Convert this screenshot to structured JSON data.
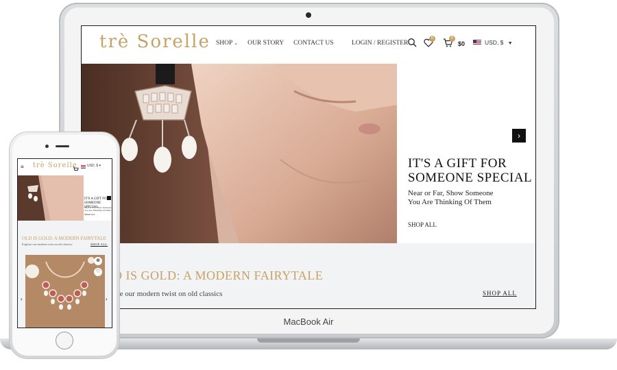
{
  "site": {
    "logo_text": "trè Sorelle",
    "nav": [
      "SHOP",
      "OUR STORY",
      "CONTACT US"
    ],
    "login_label": "LOGIN / REGISTER",
    "wishlist_count": "0",
    "cart_count": "0",
    "cart_total": "$0",
    "currency": "USD, $"
  },
  "hero": {
    "title_line1": "IT'S A GIFT FOR",
    "title_line2": "SOMEONE SPECIAL",
    "subtitle_line1": "Near or Far, Show Someone",
    "subtitle_line2": "You Are Thinking Of Them",
    "link_label": "SHOP ALL",
    "next_icon": "›"
  },
  "collection": {
    "title_visible": "D IS GOLD: A MODERN FAIRYTALE",
    "subtitle_visible": "re our modern twist on old classics",
    "link_label": "SHOP ALL"
  },
  "device": {
    "brand_label": "MacBook Air"
  },
  "phone": {
    "logo_text": "trè Sorelle",
    "currency": "USD, $",
    "hero_title": "IT'S A GIFT FOR SOMEONE SPECIAL",
    "hero_sub": "Near or Far, Show Someone You Are Thinking Of Them",
    "hero_link": "SHOP ALL",
    "section_title": "OLD IS GOLD: A MODERN FAIRYTALE",
    "section_sub": "Explore our modern twist on old classics",
    "section_link": "SHOP ALL"
  },
  "colors": {
    "accent_gold": "#c8a165",
    "text_dark": "#111111",
    "section_bg": "#f2f3f4"
  }
}
